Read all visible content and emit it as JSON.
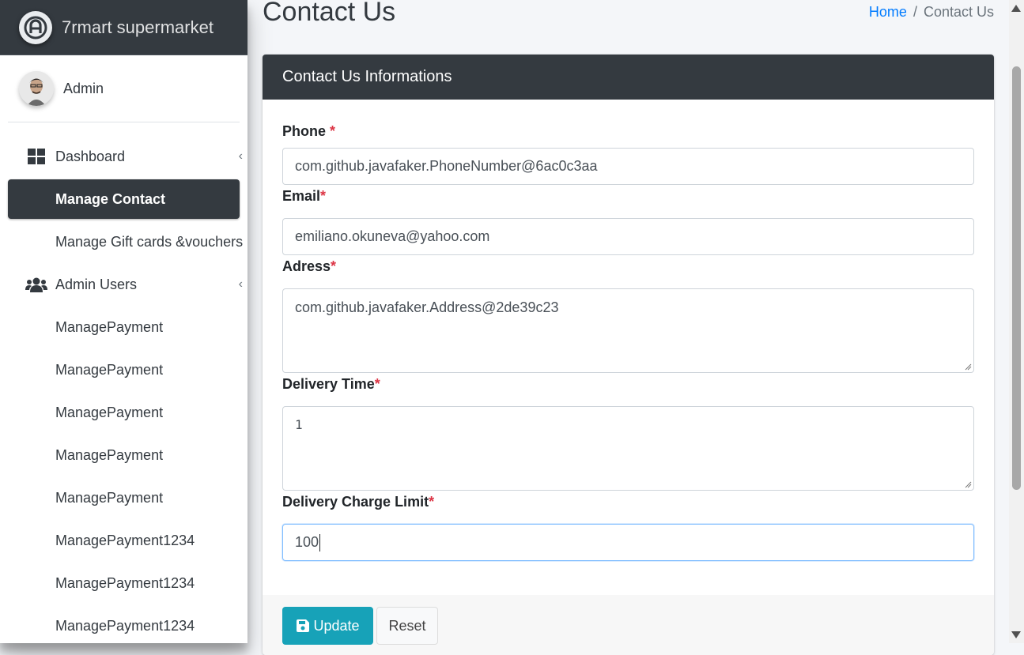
{
  "brand": {
    "name": "7rmart supermarket",
    "logo_icon": "brand-logo-icon"
  },
  "user": {
    "name": "Admin"
  },
  "sidebar": {
    "items": [
      {
        "label": "Dashboard",
        "icon": "dashboard-icon",
        "has_arrow": true
      },
      {
        "label": "Manage Contact",
        "active": true
      },
      {
        "label": "Manage Gift cards &vouchers"
      },
      {
        "label": "Admin Users",
        "icon": "users-icon",
        "has_arrow": true
      },
      {
        "label": "ManagePayment"
      },
      {
        "label": "ManagePayment"
      },
      {
        "label": "ManagePayment"
      },
      {
        "label": "ManagePayment"
      },
      {
        "label": "ManagePayment"
      },
      {
        "label": "ManagePayment1234"
      },
      {
        "label": "ManagePayment1234"
      },
      {
        "label": "ManagePayment1234"
      }
    ]
  },
  "header": {
    "title": "Contact Us",
    "breadcrumb": {
      "home": "Home",
      "separator": "/",
      "current": "Contact Us"
    }
  },
  "card": {
    "title": "Contact Us Informations",
    "fields": {
      "phone": {
        "label": "Phone ",
        "required": "*",
        "value": "com.github.javafaker.PhoneNumber@6ac0c3aa"
      },
      "email": {
        "label": "Email",
        "required": "*",
        "value": "emiliano.okuneva@yahoo.com"
      },
      "address": {
        "label": "Adress",
        "required": "*",
        "value": "com.github.javafaker.Address@2de39c23"
      },
      "delivery_time": {
        "label": "Delivery Time",
        "required": "*",
        "value": "1"
      },
      "delivery_charge_limit": {
        "label": "Delivery Charge Limit",
        "required": "*",
        "value": "100"
      }
    },
    "buttons": {
      "update": "Update",
      "reset": "Reset"
    }
  },
  "colors": {
    "dark": "#343a40",
    "primary_link": "#007bff",
    "info": "#17a2b8",
    "required": "#dc3545"
  }
}
